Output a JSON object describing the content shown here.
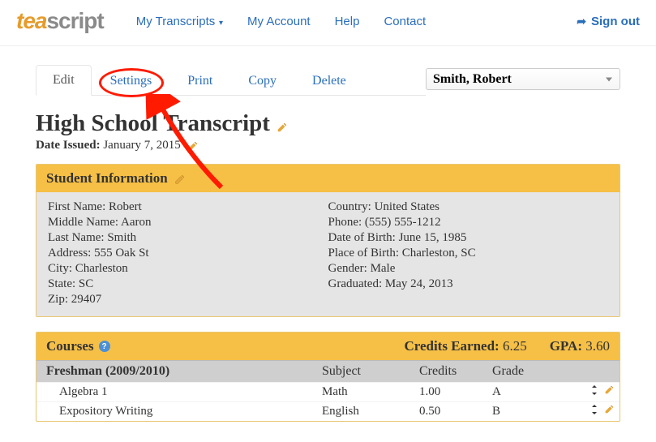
{
  "brand": {
    "part1": "tea",
    "part2": "script"
  },
  "nav": {
    "transcripts": "My Transcripts",
    "account": "My Account",
    "help": "Help",
    "contact": "Contact",
    "signout": "Sign out"
  },
  "tabs": {
    "edit": "Edit",
    "settings": "Settings",
    "print": "Print",
    "copy": "Copy",
    "delete": "Delete"
  },
  "student_select": "Smith, Robert",
  "title": "High School Transcript",
  "date_issued_label": "Date Issued:",
  "date_issued_value": "January 7, 2015",
  "student_info": {
    "header": "Student Information",
    "first_name_label": "First Name:",
    "first_name": "Robert",
    "middle_name_label": "Middle Name:",
    "middle_name": "Aaron",
    "last_name_label": "Last Name:",
    "last_name": "Smith",
    "address_label": "Address:",
    "address": "555 Oak St",
    "city_label": "City:",
    "city": "Charleston",
    "state_label": "State:",
    "state": "SC",
    "zip_label": "Zip:",
    "zip": "29407",
    "country_label": "Country:",
    "country": "United States",
    "phone_label": "Phone:",
    "phone": "(555) 555-1212",
    "dob_label": "Date of Birth:",
    "dob": "June 15, 1985",
    "pob_label": "Place of Birth:",
    "pob": "Charleston, SC",
    "gender_label": "Gender:",
    "gender": "Male",
    "graduated_label": "Graduated:",
    "graduated": "May 24, 2013"
  },
  "courses": {
    "header": "Courses",
    "credits_earned_label": "Credits Earned:",
    "credits_earned": "6.25",
    "gpa_label": "GPA:",
    "gpa": "3.60",
    "year_label": "Freshman (2009/2010)",
    "col_subject": "Subject",
    "col_credits": "Credits",
    "col_grade": "Grade",
    "rows": [
      {
        "name": "Algebra 1",
        "subject": "Math",
        "credits": "1.00",
        "grade": "A"
      },
      {
        "name": "Expository Writing",
        "subject": "English",
        "credits": "0.50",
        "grade": "B"
      }
    ]
  }
}
